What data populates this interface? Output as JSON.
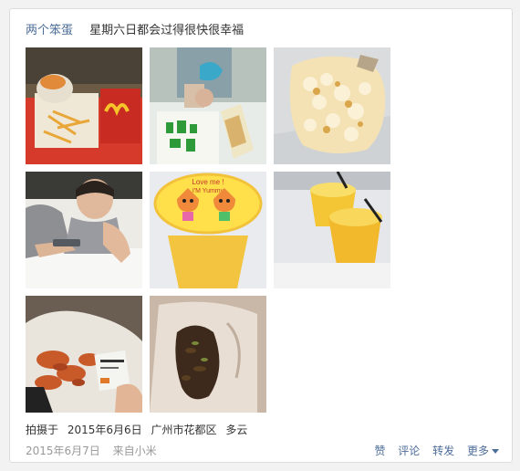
{
  "post": {
    "author": "两个笨蛋",
    "status_text": "星期六日都会过得很快很幸福"
  },
  "photos": [
    {
      "subject": "mcdonalds-fries-tray"
    },
    {
      "subject": "shopping-bag-snacks"
    },
    {
      "subject": "popcorn-bag"
    },
    {
      "subject": "person-with-phone"
    },
    {
      "subject": "juice-cup-lid-cartoon"
    },
    {
      "subject": "juice-cups-with-straws"
    },
    {
      "subject": "bag-of-crayfish"
    },
    {
      "subject": "bag-of-dark-food"
    }
  ],
  "meta": {
    "taken_label": "拍摄于",
    "taken_date": "2015年6月6日",
    "location": "广州市花都区",
    "weather": "多云"
  },
  "footer": {
    "date": "2015年6月7日",
    "source": "来自小米"
  },
  "actions": {
    "like": "赞",
    "comment": "评论",
    "share": "转发",
    "more": "更多"
  },
  "lid_text": {
    "line1": "Love me !",
    "line2": "I'M Yummy"
  }
}
